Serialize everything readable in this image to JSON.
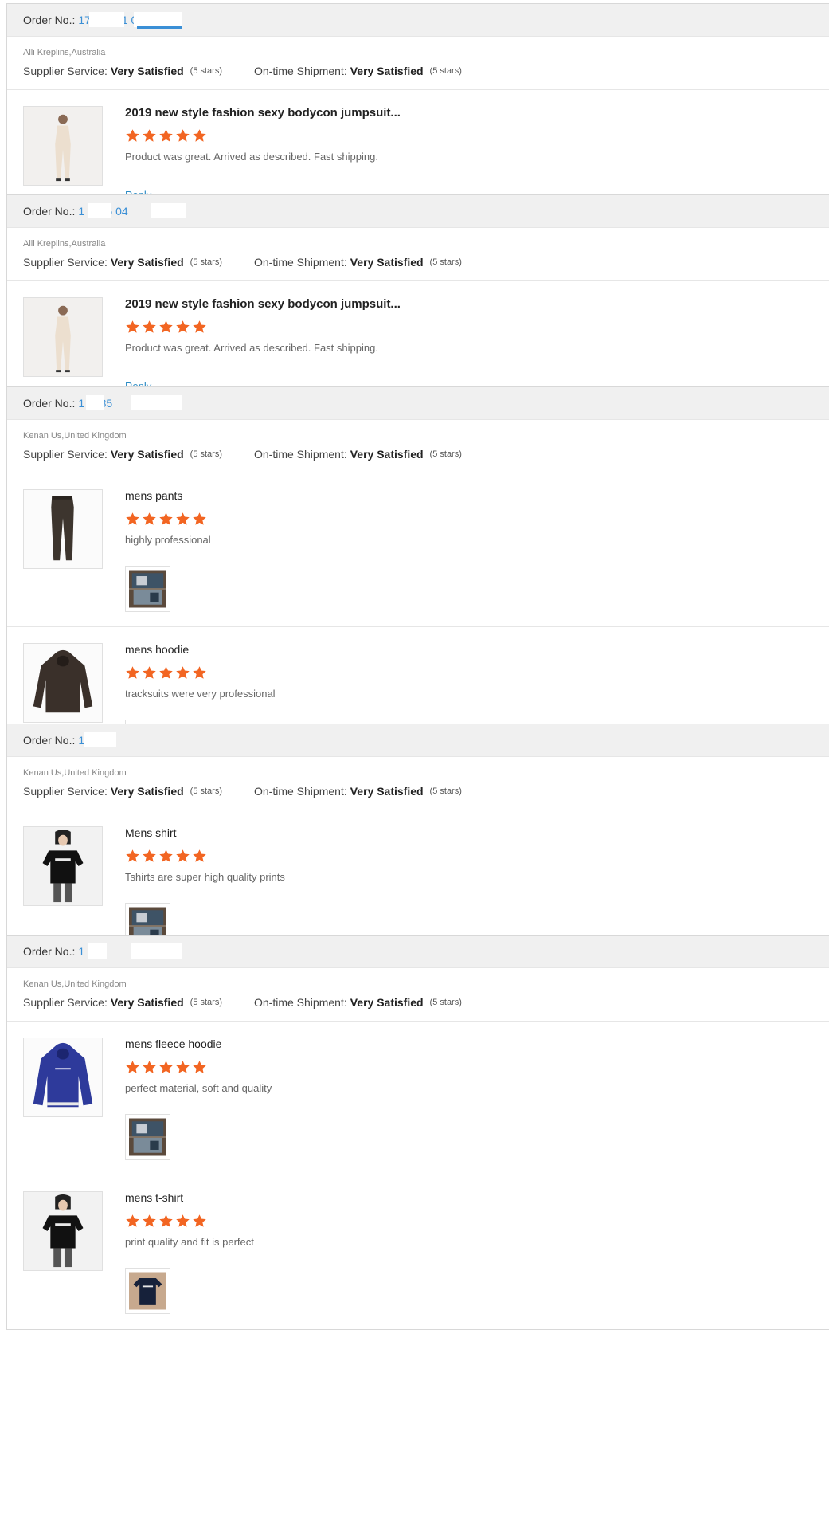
{
  "labels": {
    "order_no": "Order No.:",
    "supplier_service": "Supplier Service:",
    "ontime_shipment": "On-time Shipment:",
    "reply": "Reply"
  },
  "star_color": "#f26522",
  "link_color": "#3a8fd6",
  "orders": [
    {
      "order_number": "17 0 1 5 1 0 0",
      "buyer": "Alli Kreplins,Australia",
      "supplier_service": "Very Satisfied",
      "supplier_stars": "(5 stars)",
      "ontime_shipment": "Very Satisfied",
      "ontime_stars": "(5 stars)",
      "items": [
        {
          "title": "2019 new style fashion sexy bodycon jumpsuit...",
          "rating": 5,
          "comment": "Product was great. Arrived as described. Fast shipping.",
          "thumbnail_icon": "jumpsuit-photo",
          "has_photo": false,
          "has_reply": true
        }
      ]
    },
    {
      "order_number": "1 0315 04",
      "buyer": "Alli Kreplins,Australia",
      "supplier_service": "Very Satisfied",
      "supplier_stars": "(5 stars)",
      "ontime_shipment": "Very Satisfied",
      "ontime_stars": "(5 stars)",
      "items": [
        {
          "title": "2019 new style fashion sexy bodycon jumpsuit...",
          "rating": 5,
          "comment": "Product was great. Arrived as described. Fast shipping.",
          "thumbnail_icon": "jumpsuit-photo",
          "has_photo": false,
          "has_reply": true
        }
      ]
    },
    {
      "order_number": "1 7785",
      "buyer": "Kenan Us,United Kingdom",
      "supplier_service": "Very Satisfied",
      "supplier_stars": "(5 stars)",
      "ontime_shipment": "Very Satisfied",
      "ontime_stars": "(5 stars)",
      "items": [
        {
          "title": "mens pants",
          "rating": 5,
          "comment": "highly professional",
          "thumbnail_icon": "pants-photo",
          "has_photo": true,
          "photo_icon": "package-photo",
          "has_reply": false
        },
        {
          "title": "mens hoodie",
          "rating": 5,
          "comment": "tracksuits were very professional",
          "thumbnail_icon": "hoodie-photo",
          "has_photo": true,
          "photo_icon": "package-photo",
          "has_reply": false
        }
      ]
    },
    {
      "order_number": "1 265",
      "buyer": "Kenan Us,United Kingdom",
      "supplier_service": "Very Satisfied",
      "supplier_stars": "(5 stars)",
      "ontime_shipment": "Very Satisfied",
      "ontime_stars": "(5 stars)",
      "items": [
        {
          "title": "Mens shirt",
          "rating": 5,
          "comment": "Tshirts are super high quality prints",
          "thumbnail_icon": "tshirt-model-photo",
          "has_photo": true,
          "photo_icon": "package-photo",
          "has_reply": false
        }
      ]
    },
    {
      "order_number": "1 54",
      "buyer": "Kenan Us,United Kingdom",
      "supplier_service": "Very Satisfied",
      "supplier_stars": "(5 stars)",
      "ontime_shipment": "Very Satisfied",
      "ontime_stars": "(5 stars)",
      "items": [
        {
          "title": "mens fleece hoodie",
          "rating": 5,
          "comment": "perfect material, soft and quality",
          "thumbnail_icon": "blue-hoodie-photo",
          "has_photo": true,
          "photo_icon": "package-photo",
          "has_reply": false
        },
        {
          "title": "mens t-shirt",
          "rating": 5,
          "comment": "print quality and fit is perfect",
          "thumbnail_icon": "tshirt-model-photo",
          "has_photo": true,
          "photo_icon": "tshirt-photo",
          "has_reply": false
        }
      ]
    }
  ]
}
